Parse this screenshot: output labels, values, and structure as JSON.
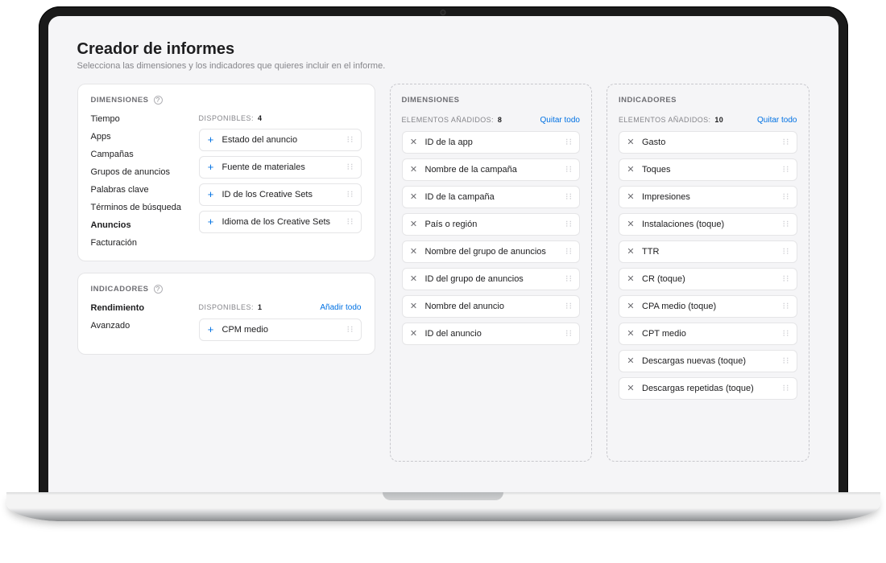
{
  "header": {
    "title": "Creador de informes",
    "subtitle": "Selecciona las dimensiones y los indicadores que quieres incluir en el informe."
  },
  "labels": {
    "dimensions": "DIMENSIONES",
    "indicators": "INDICADORES",
    "available": "DISPONIBLES:",
    "added": "ELEMENTOS AÑADIDOS:",
    "add_all": "Añadir todo",
    "remove_all": "Quitar todo"
  },
  "dimensions_panel": {
    "tabs": [
      {
        "label": "Tiempo",
        "active": false
      },
      {
        "label": "Apps",
        "active": false
      },
      {
        "label": "Campañas",
        "active": false
      },
      {
        "label": "Grupos de anuncios",
        "active": false
      },
      {
        "label": "Palabras clave",
        "active": false
      },
      {
        "label": "Términos de búsqueda",
        "active": false
      },
      {
        "label": "Anuncios",
        "active": true
      },
      {
        "label": "Facturación",
        "active": false
      }
    ],
    "available_count": "4",
    "available_items": [
      "Estado del anuncio",
      "Fuente de materiales",
      "ID de los Creative Sets",
      "Idioma de los Creative Sets"
    ]
  },
  "indicators_panel": {
    "tabs": [
      {
        "label": "Rendimiento",
        "active": true
      },
      {
        "label": "Avanzado",
        "active": false
      }
    ],
    "available_count": "1",
    "available_items": [
      "CPM medio"
    ]
  },
  "selected_dimensions": {
    "count": "8",
    "items": [
      "ID de la app",
      "Nombre de la campaña",
      "ID de la campaña",
      "País o región",
      "Nombre del grupo de anuncios",
      "ID del grupo de anuncios",
      "Nombre del anuncio",
      "ID del anuncio"
    ]
  },
  "selected_indicators": {
    "count": "10",
    "items": [
      "Gasto",
      "Toques",
      "Impresiones",
      "Instalaciones (toque)",
      "TTR",
      "CR (toque)",
      "CPA medio (toque)",
      "CPT medio",
      "Descargas nuevas (toque)",
      "Descargas repetidas (toque)"
    ]
  }
}
